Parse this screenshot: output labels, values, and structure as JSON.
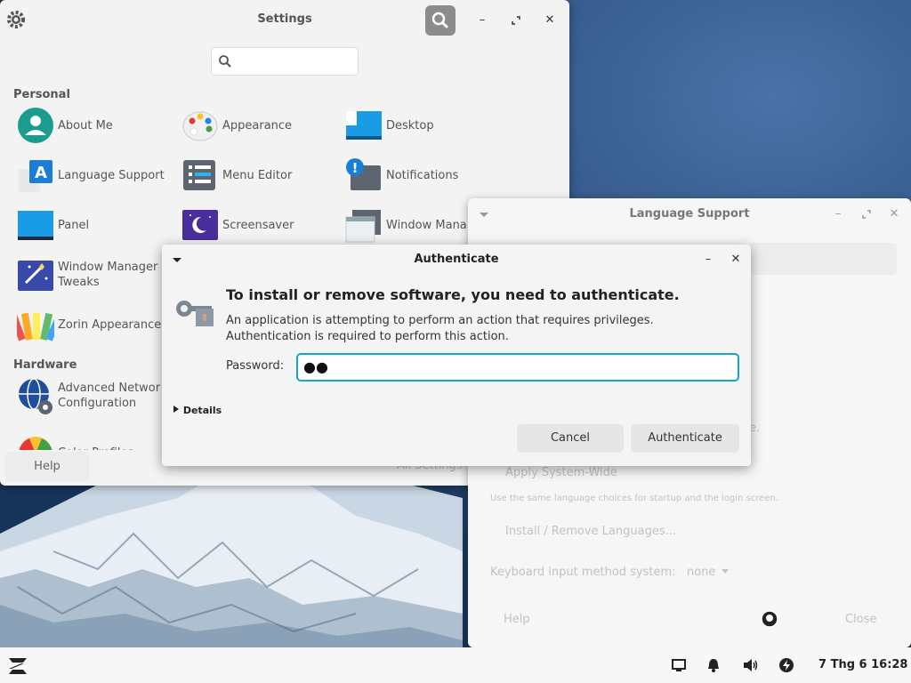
{
  "settings": {
    "title": "Settings",
    "search_placeholder": "",
    "personal_label": "Personal",
    "hardware_label": "Hardware",
    "items": [
      {
        "label": "About Me",
        "icon": "user-icon"
      },
      {
        "label": "Appearance",
        "icon": "palette-icon"
      },
      {
        "label": "Desktop",
        "icon": "desktop-icon"
      },
      {
        "label": "Language Support",
        "icon": "language-icon"
      },
      {
        "label": "Menu Editor",
        "icon": "menu-editor-icon"
      },
      {
        "label": "Notifications",
        "icon": "notification-icon"
      },
      {
        "label": "Panel",
        "icon": "panel-icon"
      },
      {
        "label": "Screensaver",
        "icon": "screensaver-icon"
      },
      {
        "label": "Window Mana",
        "icon": "window-manager-icon"
      },
      {
        "label_line1": "Window Manager",
        "label_line2": "Tweaks",
        "icon": "window-tweaks-icon"
      },
      {
        "label": "Zorin Appearance",
        "icon": "zorin-appearance-icon"
      }
    ],
    "hardware_items": [
      {
        "label_line1": "Advanced Networ",
        "label_line2": "Configuration",
        "icon": "network-icon"
      },
      {
        "label": "Color Profiles",
        "icon": "color-profiles-icon"
      }
    ],
    "help": "Help",
    "all_settings": "All Settings"
  },
  "lang": {
    "title": "Language Support",
    "partial_text": "e.",
    "apply": "Apply System-Wide",
    "note": "Use the same language choices for startup and the login screen.",
    "install": "Install / Remove Languages...",
    "keyboard_label": "Keyboard input method system:",
    "keyboard_value": "none",
    "help": "Help",
    "close": "Close"
  },
  "auth": {
    "title": "Authenticate",
    "heading": "To install or remove software, you need to authenticate.",
    "body": "An application is attempting to perform an action that requires privileges. Authentication is required to perform this action.",
    "password_label": "Password:",
    "password_value": "●●",
    "details": "Details",
    "cancel": "Cancel",
    "authenticate": "Authenticate"
  },
  "taskbar": {
    "clock": "7 Thg 6 16:28"
  },
  "colors": {
    "accent": "#15a6c8",
    "panel_blue": "#1a9be6"
  }
}
